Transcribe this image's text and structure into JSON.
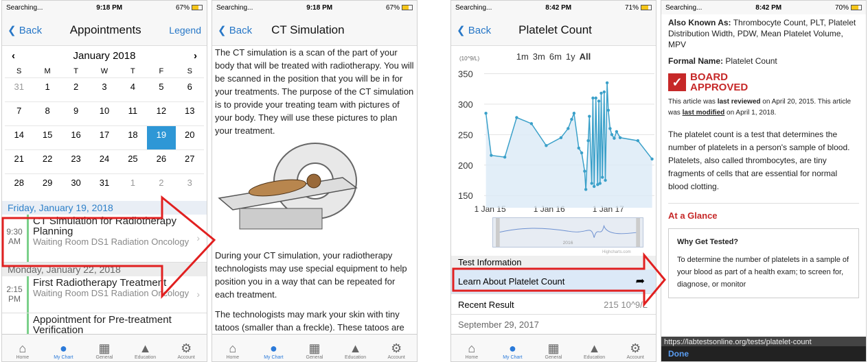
{
  "accent": "#2777c7",
  "arrow_color": "#e12020",
  "tabs": [
    "Home",
    "My Chart",
    "General",
    "Education",
    "Account"
  ],
  "screen1": {
    "status": {
      "left": "Searching...",
      "time": "9:18 PM",
      "battery": "67%"
    },
    "back": "Back",
    "title": "Appointments",
    "legend": "Legend",
    "month": "January 2018",
    "dows": [
      "S",
      "M",
      "T",
      "W",
      "T",
      "F",
      "S"
    ],
    "days": [
      "31",
      "1",
      "2",
      "3",
      "4",
      "5",
      "6",
      "7",
      "8",
      "9",
      "10",
      "11",
      "12",
      "13",
      "14",
      "15",
      "16",
      "17",
      "18",
      "19",
      "20",
      "21",
      "22",
      "23",
      "24",
      "25",
      "26",
      "27",
      "28",
      "29",
      "30",
      "31",
      "1",
      "2",
      "3"
    ],
    "date1": "Friday, January 19, 2018",
    "appt1": {
      "time": "9:30 AM",
      "title": "CT Simulation for Radiotherapy Planning",
      "loc": "Waiting Room DS1 Radiation Oncology"
    },
    "date2": "Monday, January 22, 2018",
    "appt2": {
      "time": "2:15 PM",
      "title": "First Radiotherapy Treatment",
      "loc": "Waiting Room DS1 Radiation Oncology"
    },
    "appt3": {
      "title": "Appointment for Pre-treatment Verification"
    }
  },
  "screen2": {
    "status": {
      "left": "Searching...",
      "time": "9:18 PM",
      "battery": "67%"
    },
    "back": "Back",
    "title": "CT Simulation",
    "para1": "The CT simulation is a scan of the part of your body that will be treated with radiotherapy. You will be scanned in the position that you will be in for your treatments. The purpose of the CT simulation is to provide your treating team with pictures of your body. They will use these pictures to plan your treatment.",
    "para2": "During your CT simulation, your radiotherapy technologists may use special equipment to help position you in a way that can be repeated for each treatment.",
    "para3": "The technologists may mark your skin with tiny tatoos (smaller than a freckle). These tatoos are permanent and will be used as"
  },
  "screen3": {
    "status": {
      "left": "Searching...",
      "time": "8:42 PM",
      "battery": "71%"
    },
    "back": "Back",
    "title": "Platelet Count",
    "ranges": [
      "1m",
      "3m",
      "6m",
      "1y",
      "All"
    ],
    "unit": "(10^9/L)",
    "nav_year": "2016",
    "credit": "Highcharts.com",
    "section": "Test Information",
    "learn": "Learn About Platelet Count",
    "recent_label": "Recent Result",
    "recent_value": "215 10^9/L",
    "recent_date": "September 29, 2017"
  },
  "chart_data": {
    "type": "line",
    "title": "",
    "xlabel": "",
    "ylabel": "(10^9/L)",
    "ylim": [
      130,
      355
    ],
    "yticks": [
      150,
      200,
      250,
      300,
      350
    ],
    "xticks": [
      "1 Jan 15",
      "1 Jan 16",
      "1 Jan 17"
    ],
    "x": [
      2014.93,
      2015.02,
      2015.25,
      2015.45,
      2015.7,
      2015.95,
      2016.2,
      2016.32,
      2016.38,
      2016.42,
      2016.5,
      2016.55,
      2016.6,
      2016.62,
      2016.66,
      2016.68,
      2016.72,
      2016.74,
      2016.76,
      2016.79,
      2016.82,
      2016.84,
      2016.86,
      2016.88,
      2016.9,
      2016.93,
      2016.95,
      2016.98,
      2017.0,
      2017.03,
      2017.06,
      2017.1,
      2017.14,
      2017.2,
      2017.5,
      2017.74
    ],
    "y": [
      285,
      216,
      213,
      278,
      268,
      232,
      245,
      260,
      275,
      285,
      228,
      220,
      190,
      160,
      240,
      280,
      170,
      310,
      165,
      310,
      168,
      305,
      170,
      318,
      180,
      320,
      175,
      335,
      290,
      260,
      250,
      244,
      255,
      245,
      240,
      210
    ],
    "grid": true,
    "legend": "none"
  },
  "screen4": {
    "status": {
      "left": "Searching...",
      "time": "8:42 PM",
      "battery": "70%"
    },
    "aka_label": "Also Known As:",
    "aka": "Thrombocyte Count, PLT, Platelet Distribution Width, PDW, Mean Platelet Volume, MPV",
    "formal_label": "Formal Name:",
    "formal": "Platelet Count",
    "board1": "BOARD",
    "board2": "APPROVED",
    "rev1": "This article was",
    "rev2": "last reviewed",
    "rev3": "on April 20, 2015. This article was",
    "rev4": "last modified",
    "rev5": "on April 1, 2018.",
    "body": "The platelet count is a test that determines the number of platelets in a person's sample of blood. Platelets, also called thrombocytes, are tiny fragments of cells that are essential for normal blood clotting.",
    "glance": "At a Glance",
    "why": "Why Get Tested?",
    "why_text": "To determine the number of platelets in a sample of your blood as part of a health exam; to screen for, diagnose, or monitor",
    "url": "https://labtestsonline.org/tests/platelet-count",
    "done": "Done"
  }
}
